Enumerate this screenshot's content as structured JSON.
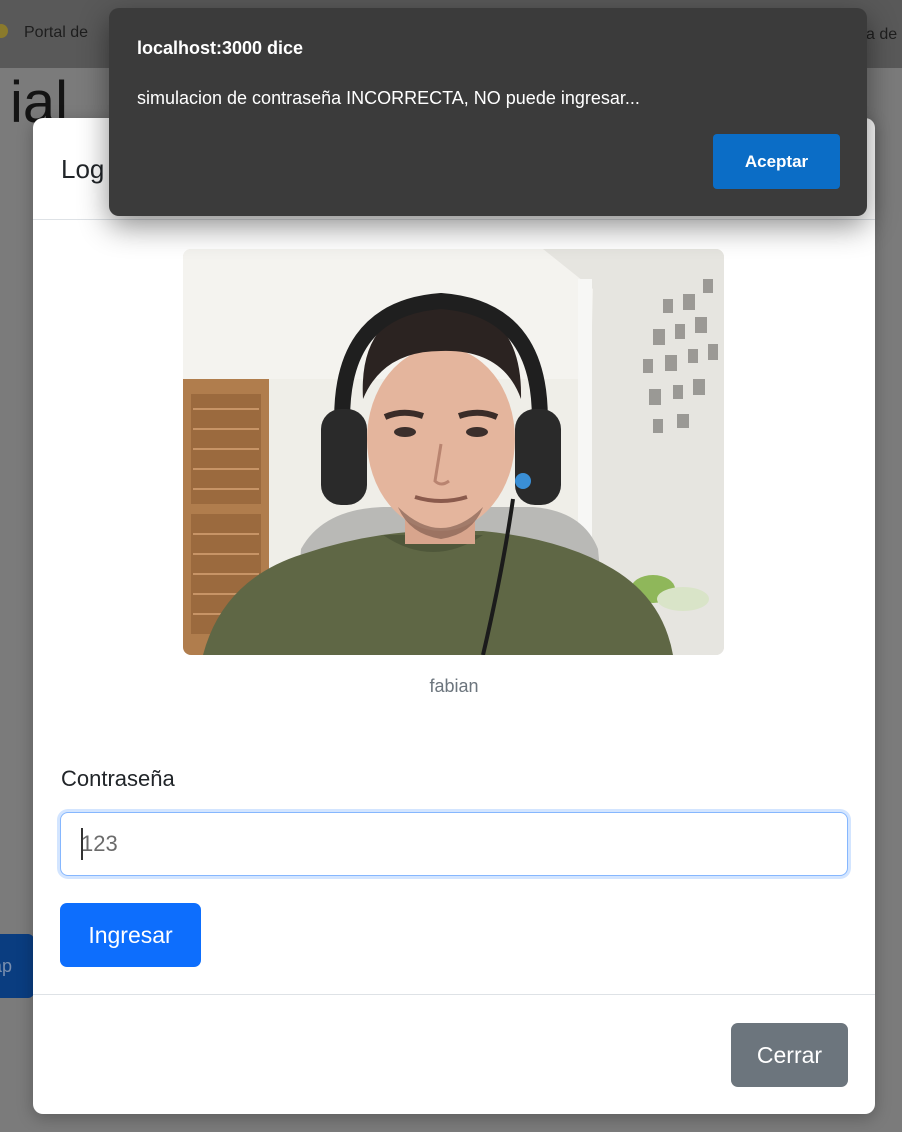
{
  "background": {
    "nav_left": "Portal de",
    "nav_right": "a de",
    "heading": "ial",
    "button_fragment": "ap"
  },
  "modal": {
    "title": "Log",
    "caption": "fabian",
    "password_label": "Contraseña",
    "password_value": "123",
    "submit_label": "Ingresar",
    "close_label": "Cerrar"
  },
  "alert": {
    "origin": "localhost:3000 dice",
    "message": "simulacion de contraseña INCORRECTA, NO puede ingresar...",
    "ok_label": "Aceptar"
  },
  "colors": {
    "primary": "#0d6efd",
    "secondary": "#6c757d",
    "alert_bg": "#3b3b3b",
    "alert_button": "#0b6dc6"
  }
}
